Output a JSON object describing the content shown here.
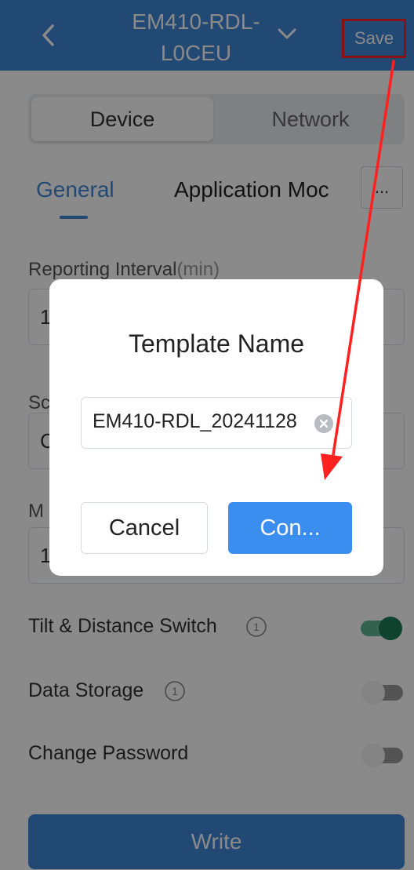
{
  "header": {
    "title": "EM410-RDL-L0CEU",
    "save_label": "Save"
  },
  "segments": {
    "device": "Device",
    "network": "Network"
  },
  "tabs": {
    "general": "General",
    "application": "Application Moc",
    "more": "..."
  },
  "form": {
    "reporting_interval_label": "Reporting Interval",
    "reporting_interval_unit": "(min)",
    "reporting_interval_value": "1",
    "second_label": "Sc",
    "second_value": "C",
    "third_label": "M",
    "third_value": "1"
  },
  "switches": {
    "tilt_distance": {
      "label": "Tilt & Distance Switch",
      "on": true
    },
    "data_storage": {
      "label": "Data Storage",
      "on": false
    },
    "change_password": {
      "label": "Change Password",
      "on": false
    }
  },
  "write_label": "Write",
  "dialog": {
    "title": "Template Name",
    "input_value": "EM410-RDL_20241128",
    "cancel_label": "Cancel",
    "confirm_label": "Con..."
  },
  "colors": {
    "brand": "#3f86d6",
    "confirm": "#3a8ef0",
    "toggle_on": "#1f7a5a",
    "annotation": "#ff2020"
  }
}
